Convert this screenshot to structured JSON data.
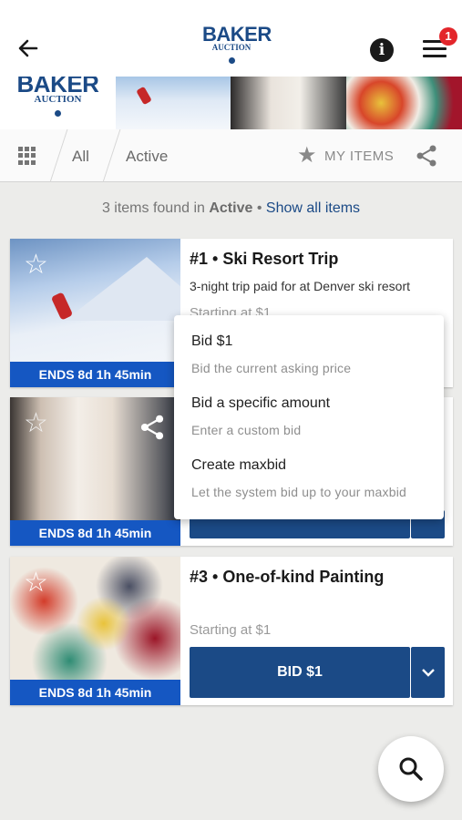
{
  "header": {
    "logo_main": "BAKER",
    "logo_sub": "AUCTION",
    "info_glyph": "i",
    "notification_count": "1"
  },
  "banner": {
    "logo_main": "BAKER",
    "logo_sub": "AUCTION"
  },
  "tabs": {
    "all_label": "All",
    "active_label": "Active",
    "my_items_label": "MY ITEMS"
  },
  "results": {
    "prefix": "3 items found in",
    "filter": "Active",
    "separator": "•",
    "show_all": "Show all items"
  },
  "items": [
    {
      "title": "#1 • Ski Resort Trip",
      "description": "3-night trip paid for at Denver ski resort",
      "starting": "Starting at $1",
      "ends": "ENDS 8d 1h 45min"
    },
    {
      "ends": "ENDS 8d 1h 45min"
    },
    {
      "title": "#3 • One-of-kind Painting",
      "starting": "Starting at $1",
      "ends": "ENDS 8d 1h 45min",
      "bid_label": "BID $1"
    }
  ],
  "popup": {
    "options": [
      {
        "title": "Bid $1",
        "subtitle": "Bid the current asking price"
      },
      {
        "title": "Bid a specific amount",
        "subtitle": "Enter a custom bid"
      },
      {
        "title": "Create maxbid",
        "subtitle": "Let the system bid up to your maxbid"
      }
    ]
  },
  "icons": {
    "back": "arrow-left-icon",
    "info": "info-icon",
    "menu": "hamburger-menu-icon",
    "grid": "grid-view-icon",
    "star": "star-icon",
    "share": "share-icon",
    "chevron": "chevron-down-icon",
    "search": "search-icon"
  },
  "colors": {
    "brand": "#1b4a86",
    "ends_bar": "#1557c2",
    "badge": "#e3262b",
    "background": "#ececea"
  }
}
